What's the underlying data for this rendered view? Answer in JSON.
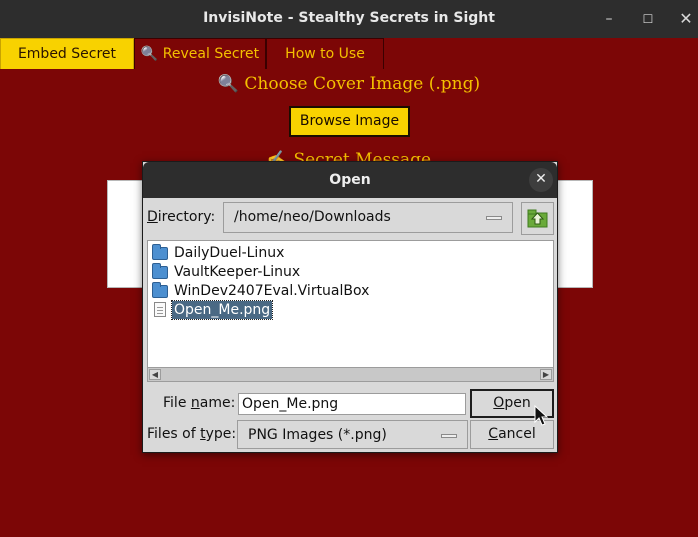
{
  "window": {
    "title": "InvisiNote - Stealthy Secrets in Sight",
    "minimize": "–",
    "maximize": "☐",
    "close": "✕"
  },
  "tabs": [
    {
      "label": "Embed Secret",
      "active": true
    },
    {
      "label": "🔍 Reveal Secret",
      "active": false
    },
    {
      "label": "How to Use",
      "active": false
    }
  ],
  "main": {
    "cover_heading": "🔍 Choose Cover Image (.png)",
    "browse_label": "Browse Image",
    "secret_heading": "✍ Secret Message"
  },
  "dialog": {
    "title": "Open",
    "close": "✕",
    "directory_label_pre": "D",
    "directory_label_post": "irectory:",
    "directory_value": "/home/neo/Downloads",
    "files": [
      {
        "name": "DailyDuel-Linux",
        "type": "folder"
      },
      {
        "name": "VaultKeeper-Linux",
        "type": "folder"
      },
      {
        "name": "WinDev2407Eval.VirtualBox",
        "type": "folder"
      },
      {
        "name": "Open_Me.png",
        "type": "file",
        "selected": true
      }
    ],
    "filename_label_pre": "File ",
    "filename_label_u": "n",
    "filename_label_post": "ame:",
    "filename_value": "Open_Me.png",
    "filetype_label_pre": "Files of ",
    "filetype_label_u": "t",
    "filetype_label_post": "ype:",
    "filetype_value": "PNG Images (*.png)",
    "open_u": "O",
    "open_post": "pen",
    "cancel_u": "C",
    "cancel_post": "ancel"
  },
  "colors": {
    "background": "#7c0606",
    "accent": "#f8d200",
    "heading_text": "#f4c000",
    "selection": "#4a6984"
  }
}
